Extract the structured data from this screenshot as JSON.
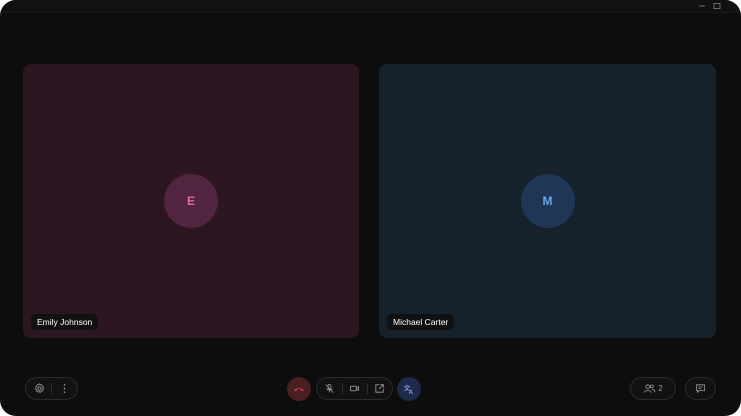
{
  "window": {
    "controls": [
      "minimize-icon",
      "maximize-icon"
    ]
  },
  "participants": [
    {
      "initial": "E",
      "name": "Emily Johnson",
      "color": "#e06aa7",
      "tile_color": "#2b1622"
    },
    {
      "initial": "M",
      "name": "Michael Carter",
      "color": "#6ba4e6",
      "tile_color": "#15212b"
    }
  ],
  "toolbar": {
    "left": [
      "settings-icon",
      "more-vertical-icon"
    ],
    "center": [
      "end-call-icon",
      "mic-off-icon",
      "camera-icon",
      "share-screen-icon",
      "translate-icon"
    ],
    "right": {
      "participants_icon": "people-icon",
      "participants_count": "2",
      "chat_icon": "chat-icon"
    },
    "colors": {
      "end_call_bg": "#4a1f22",
      "end_call_icon": "#e0444a",
      "translate_bg": "#1e2a4a",
      "translate_icon": "#7d96e8"
    }
  }
}
